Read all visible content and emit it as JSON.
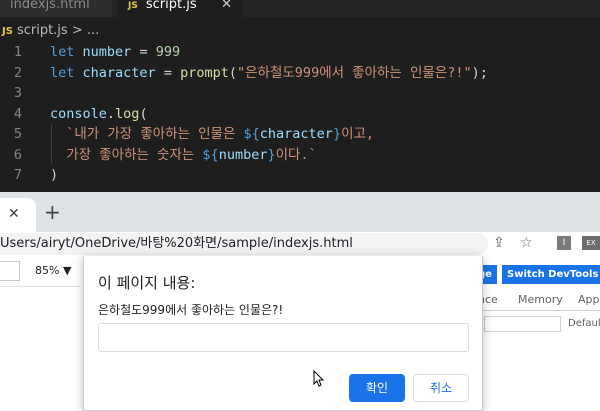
{
  "vscode": {
    "tabs": [
      {
        "label": "indexjs.html",
        "active": false
      },
      {
        "badge": "JS",
        "label": "script.js",
        "active": true
      }
    ],
    "breadcrumb": {
      "badge": "JS",
      "file": "script.js",
      "sep": ">",
      "more": "..."
    },
    "lines": [
      {
        "n": "1",
        "code": [
          {
            "t": "let",
            "c": "kw"
          },
          {
            "t": " "
          },
          {
            "t": "number",
            "c": "var"
          },
          {
            "t": " = "
          },
          {
            "t": "999",
            "c": "num"
          }
        ]
      },
      {
        "n": "2",
        "code": [
          {
            "t": "let",
            "c": "kw"
          },
          {
            "t": " "
          },
          {
            "t": "character",
            "c": "var"
          },
          {
            "t": " = "
          },
          {
            "t": "prompt",
            "c": "fn"
          },
          {
            "t": "("
          },
          {
            "t": "\"은하철도999에서 좋아하는 인물은?!\"",
            "c": "str"
          },
          {
            "t": ");"
          }
        ]
      },
      {
        "n": "3",
        "code": []
      },
      {
        "n": "4",
        "code": [
          {
            "t": "console",
            "c": "var"
          },
          {
            "t": "."
          },
          {
            "t": "log",
            "c": "fn"
          },
          {
            "t": "("
          }
        ]
      },
      {
        "n": "5",
        "code": [
          {
            "t": "  `내가 가장 좋아하는 인물은 ",
            "c": "str"
          },
          {
            "t": "${",
            "c": "tplp"
          },
          {
            "t": "character",
            "c": "var"
          },
          {
            "t": "}",
            "c": "tplp"
          },
          {
            "t": "이고,",
            "c": "str"
          }
        ]
      },
      {
        "n": "6",
        "code": [
          {
            "t": "  가장 좋아하는 숫자는 ",
            "c": "str"
          },
          {
            "t": "${",
            "c": "tplp"
          },
          {
            "t": "number",
            "c": "var"
          },
          {
            "t": "}",
            "c": "tplp"
          },
          {
            "t": "이다.`",
            "c": "str"
          }
        ]
      },
      {
        "n": "7",
        "code": [
          {
            "t": ")"
          }
        ]
      }
    ]
  },
  "chrome": {
    "close_tab_glyph": "✕",
    "new_tab_glyph": "+",
    "url": "Users/airyt/OneDrive/바탕%20화면/sample/indexjs.html",
    "zoom": "85% ▼",
    "ext1": "I",
    "ext2": "EX",
    "devtools_btn1": "ge",
    "devtools_btn2": "Switch DevTools to",
    "devtools_tabs": [
      "nce",
      "Memory",
      "App"
    ],
    "devtools_default": "Default"
  },
  "dialog": {
    "title": "이 페이지 내용:",
    "message": "은하철도999에서 좋아하는 인물은?!",
    "input_value": "",
    "ok_label": "확인",
    "cancel_label": "취소"
  },
  "colors": {
    "accent": "#1a73e8",
    "editor_bg": "#1e1e1e"
  }
}
